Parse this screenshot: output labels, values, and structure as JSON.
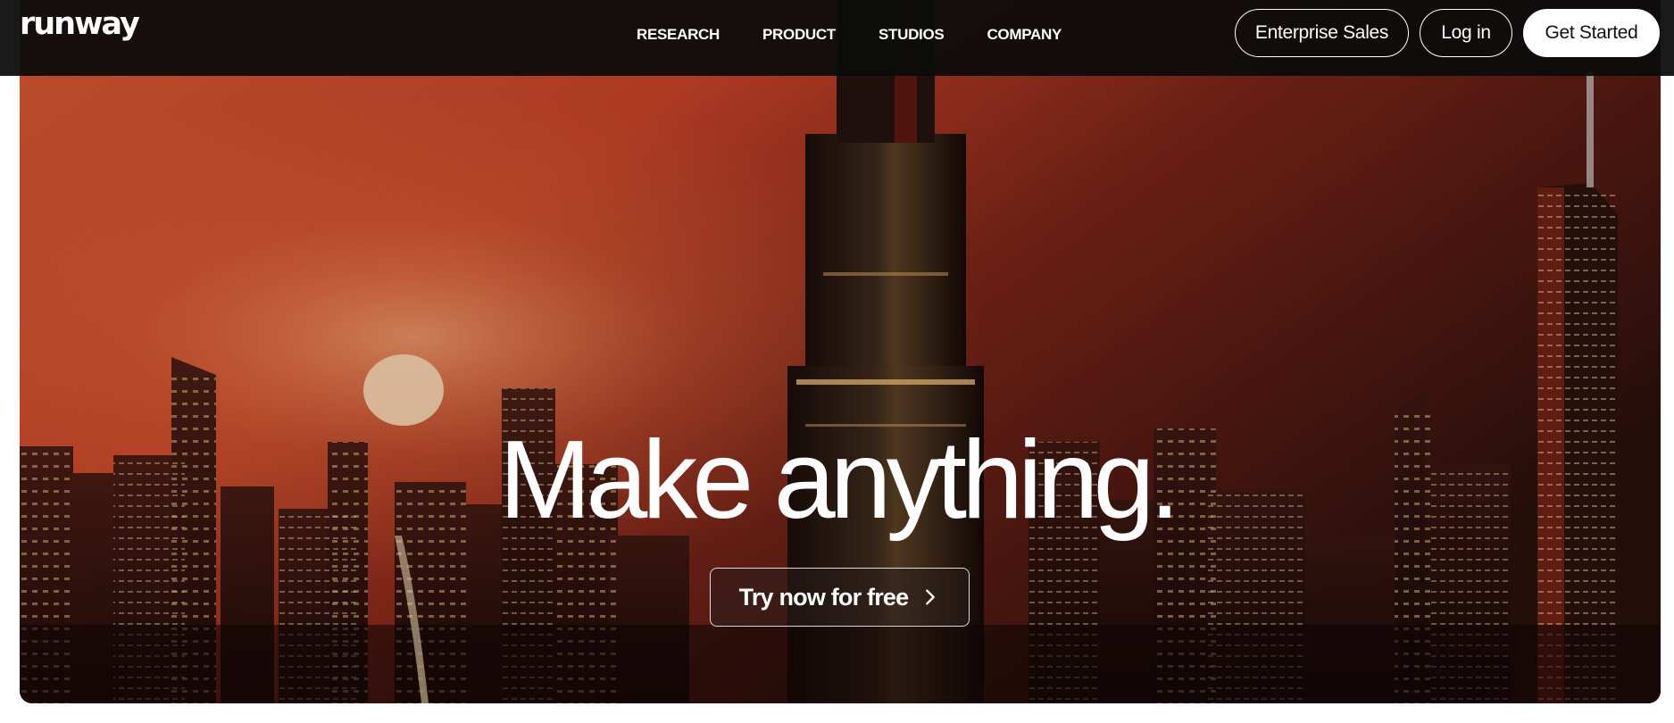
{
  "brand": {
    "logo_text": "runway"
  },
  "nav": {
    "links": [
      "RESEARCH",
      "PRODUCT",
      "STUDIOS",
      "COMPANY"
    ],
    "buttons": {
      "enterprise": "Enterprise Sales",
      "login": "Log in",
      "get_started": "Get Started"
    }
  },
  "hero": {
    "headline": "Make anything.",
    "cta_label": "Try now for free",
    "cta_icon": "chevron-right-icon",
    "background": "city-skyline-at-sunset-image"
  },
  "colors": {
    "nav_bg": "#0c0c0c",
    "accent_sky": "#c9472a",
    "text": "#ffffff"
  }
}
